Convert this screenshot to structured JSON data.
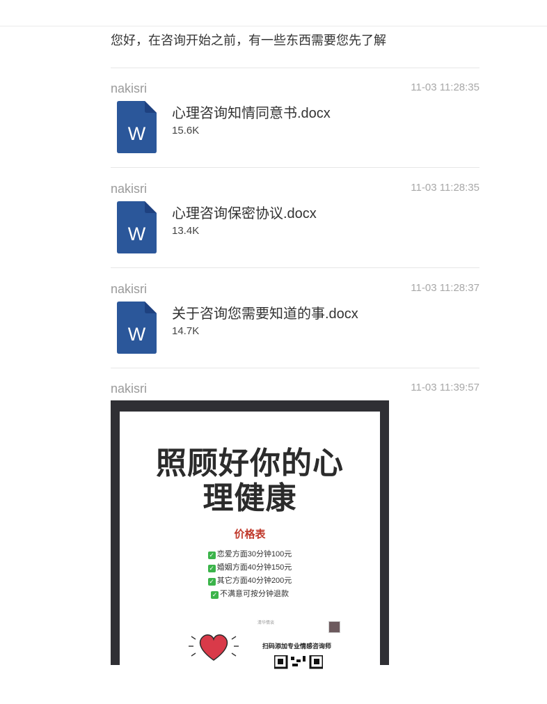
{
  "intro_text": "您好，在咨询开始之前，有一些东西需要您先了解",
  "messages": [
    {
      "sender": "nakisri",
      "time": "11-03 11:28:35",
      "file_name": "心理咨询知情同意书.docx",
      "file_size": "15.6K",
      "icon_letter": "W"
    },
    {
      "sender": "nakisri",
      "time": "11-03 11:28:35",
      "file_name": "心理咨询保密协议.docx",
      "file_size": "13.4K",
      "icon_letter": "W"
    },
    {
      "sender": "nakisri",
      "time": "11-03 11:28:37",
      "file_name": "关于咨询您需要知道的事.docx",
      "file_size": "14.7K",
      "icon_letter": "W"
    }
  ],
  "image_message": {
    "sender": "nakisri",
    "time": "11-03 11:39:57",
    "poster": {
      "title_line1": "照顾好你的心",
      "title_line2": "理健康",
      "price_heading": "价格表",
      "price_items": [
        "恋爱方面30分钟100元",
        "婚姻方面40分钟150元",
        "其它方面40分钟200元",
        "不满意可按分钟退款"
      ],
      "small_label": "清华情谈",
      "scan_text": "扫码添加专业情感咨询师"
    }
  },
  "colors": {
    "word_blue": "#2b579a",
    "poster_frame": "#2f2f34",
    "price_red": "#c0392b",
    "check_green": "#3bb44a",
    "heart_red": "#d93a49"
  }
}
